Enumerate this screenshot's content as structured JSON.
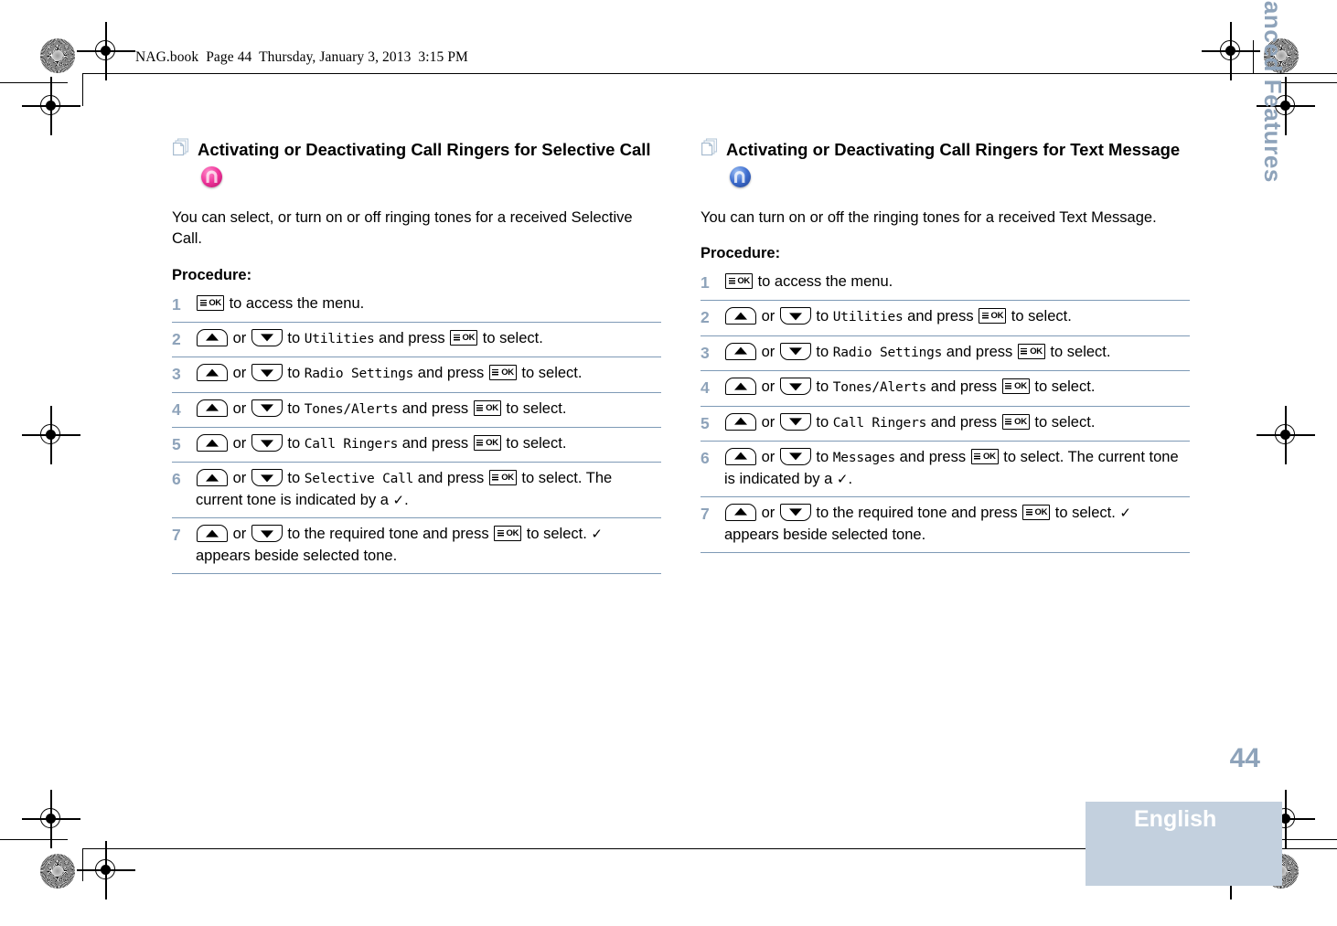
{
  "document": {
    "header_line": "NAG.book  Page 44  Thursday, January 3, 2013  3:15 PM",
    "side_tab": "Advanced Features",
    "page_number": "44",
    "language": "English",
    "accent_color": "#8ea3ba",
    "rule_color": "#7e9ab6",
    "lang_block_color": "#c3d0de"
  },
  "columns": [
    {
      "heading": "Activating or Deactivating Call Ringers for Selective Call",
      "heading_icon": "selective-call-icon",
      "heading_icon_color": "#f0359b",
      "intro": "You can select, or turn on or off ringing tones for a received Selective Call.",
      "procedure_label": "Procedure:",
      "steps": [
        {
          "num": "1",
          "parts": [
            {
              "type": "key",
              "key": "ok"
            },
            {
              "type": "text",
              "text": " to access the menu."
            }
          ]
        },
        {
          "num": "2",
          "parts": [
            {
              "type": "key",
              "key": "up"
            },
            {
              "type": "text",
              "text": " or "
            },
            {
              "type": "key",
              "key": "down"
            },
            {
              "type": "text",
              "text": " to "
            },
            {
              "type": "mono",
              "text": "Utilities"
            },
            {
              "type": "text",
              "text": " and press "
            },
            {
              "type": "key",
              "key": "ok"
            },
            {
              "type": "text",
              "text": " to select."
            }
          ]
        },
        {
          "num": "3",
          "parts": [
            {
              "type": "key",
              "key": "up"
            },
            {
              "type": "text",
              "text": " or "
            },
            {
              "type": "key",
              "key": "down"
            },
            {
              "type": "text",
              "text": " to "
            },
            {
              "type": "mono",
              "text": "Radio Settings"
            },
            {
              "type": "text",
              "text": " and press "
            },
            {
              "type": "key",
              "key": "ok"
            },
            {
              "type": "text",
              "text": " to select."
            }
          ]
        },
        {
          "num": "4",
          "parts": [
            {
              "type": "key",
              "key": "up"
            },
            {
              "type": "text",
              "text": " or "
            },
            {
              "type": "key",
              "key": "down"
            },
            {
              "type": "text",
              "text": " to "
            },
            {
              "type": "mono",
              "text": "Tones/Alerts"
            },
            {
              "type": "text",
              "text": " and press "
            },
            {
              "type": "key",
              "key": "ok"
            },
            {
              "type": "text",
              "text": " to select."
            }
          ]
        },
        {
          "num": "5",
          "parts": [
            {
              "type": "key",
              "key": "up"
            },
            {
              "type": "text",
              "text": " or "
            },
            {
              "type": "key",
              "key": "down"
            },
            {
              "type": "text",
              "text": " to "
            },
            {
              "type": "mono",
              "text": "Call Ringers"
            },
            {
              "type": "text",
              "text": " and press "
            },
            {
              "type": "key",
              "key": "ok"
            },
            {
              "type": "text",
              "text": " to select."
            }
          ]
        },
        {
          "num": "6",
          "parts": [
            {
              "type": "key",
              "key": "up"
            },
            {
              "type": "text",
              "text": " or "
            },
            {
              "type": "key",
              "key": "down"
            },
            {
              "type": "text",
              "text": " to "
            },
            {
              "type": "mono",
              "text": "Selective Call"
            },
            {
              "type": "text",
              "text": " and press "
            },
            {
              "type": "key",
              "key": "ok"
            },
            {
              "type": "text",
              "text": " to select. The current tone is indicated by a "
            },
            {
              "type": "check"
            },
            {
              "type": "text",
              "text": "."
            }
          ]
        },
        {
          "num": "7",
          "parts": [
            {
              "type": "key",
              "key": "up"
            },
            {
              "type": "text",
              "text": " or "
            },
            {
              "type": "key",
              "key": "down"
            },
            {
              "type": "text",
              "text": " to the required tone and press "
            },
            {
              "type": "key",
              "key": "ok"
            },
            {
              "type": "text",
              "text": " to select. "
            },
            {
              "type": "check"
            },
            {
              "type": "text",
              "text": " appears beside selected tone."
            }
          ]
        }
      ]
    },
    {
      "heading": "Activating or Deactivating Call Ringers for Text Message",
      "heading_icon": "text-message-icon",
      "heading_icon_color": "#3f6fd0",
      "intro": "You can turn on or off the ringing tones for a received Text Message.",
      "procedure_label": "Procedure:",
      "steps": [
        {
          "num": "1",
          "parts": [
            {
              "type": "key",
              "key": "ok"
            },
            {
              "type": "text",
              "text": " to access the menu."
            }
          ]
        },
        {
          "num": "2",
          "parts": [
            {
              "type": "key",
              "key": "up"
            },
            {
              "type": "text",
              "text": " or "
            },
            {
              "type": "key",
              "key": "down"
            },
            {
              "type": "text",
              "text": " to "
            },
            {
              "type": "mono",
              "text": "Utilities"
            },
            {
              "type": "text",
              "text": " and press "
            },
            {
              "type": "key",
              "key": "ok"
            },
            {
              "type": "text",
              "text": " to select."
            }
          ]
        },
        {
          "num": "3",
          "parts": [
            {
              "type": "key",
              "key": "up"
            },
            {
              "type": "text",
              "text": " or "
            },
            {
              "type": "key",
              "key": "down"
            },
            {
              "type": "text",
              "text": " to "
            },
            {
              "type": "mono",
              "text": "Radio Settings"
            },
            {
              "type": "text",
              "text": " and press "
            },
            {
              "type": "key",
              "key": "ok"
            },
            {
              "type": "text",
              "text": " to select."
            }
          ]
        },
        {
          "num": "4",
          "parts": [
            {
              "type": "key",
              "key": "up"
            },
            {
              "type": "text",
              "text": " or "
            },
            {
              "type": "key",
              "key": "down"
            },
            {
              "type": "text",
              "text": " to "
            },
            {
              "type": "mono",
              "text": "Tones/Alerts"
            },
            {
              "type": "text",
              "text": " and press "
            },
            {
              "type": "key",
              "key": "ok"
            },
            {
              "type": "text",
              "text": " to select."
            }
          ]
        },
        {
          "num": "5",
          "parts": [
            {
              "type": "key",
              "key": "up"
            },
            {
              "type": "text",
              "text": " or "
            },
            {
              "type": "key",
              "key": "down"
            },
            {
              "type": "text",
              "text": " to "
            },
            {
              "type": "mono",
              "text": "Call Ringers"
            },
            {
              "type": "text",
              "text": " and press "
            },
            {
              "type": "key",
              "key": "ok"
            },
            {
              "type": "text",
              "text": " to select."
            }
          ]
        },
        {
          "num": "6",
          "parts": [
            {
              "type": "key",
              "key": "up"
            },
            {
              "type": "text",
              "text": " or "
            },
            {
              "type": "key",
              "key": "down"
            },
            {
              "type": "text",
              "text": " to "
            },
            {
              "type": "mono",
              "text": "Messages"
            },
            {
              "type": "text",
              "text": " and press "
            },
            {
              "type": "key",
              "key": "ok"
            },
            {
              "type": "text",
              "text": " to select. The current tone is indicated by a "
            },
            {
              "type": "check"
            },
            {
              "type": "text",
              "text": "."
            }
          ]
        },
        {
          "num": "7",
          "parts": [
            {
              "type": "key",
              "key": "up"
            },
            {
              "type": "text",
              "text": " or "
            },
            {
              "type": "key",
              "key": "down"
            },
            {
              "type": "text",
              "text": " to the required tone and press "
            },
            {
              "type": "key",
              "key": "ok"
            },
            {
              "type": "text",
              "text": " to select. "
            },
            {
              "type": "check"
            },
            {
              "type": "text",
              "text": " appears beside selected tone."
            }
          ]
        }
      ]
    }
  ]
}
